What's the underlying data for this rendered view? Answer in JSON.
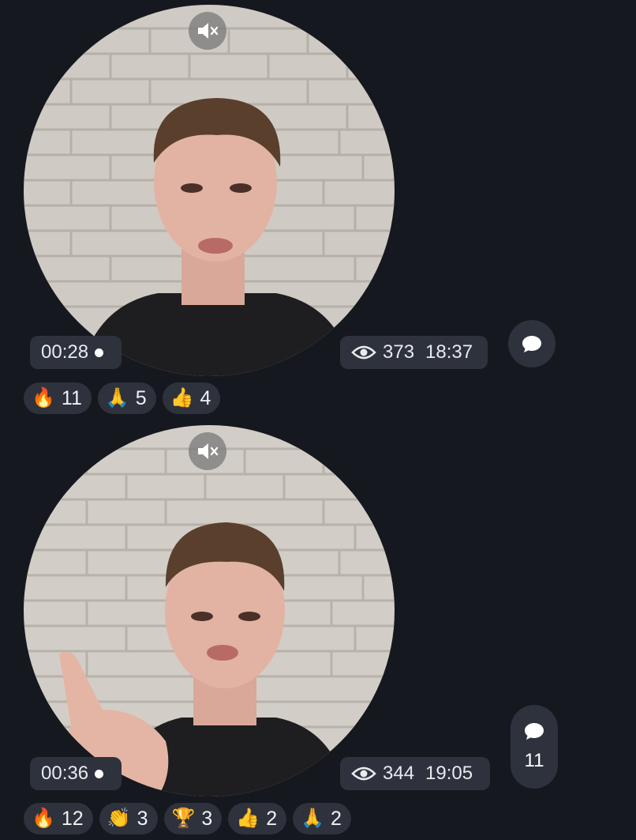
{
  "messages": [
    {
      "duration": "00:28",
      "views": "373",
      "time": "18:37",
      "comment_count": "",
      "reactions": [
        {
          "emoji": "🔥",
          "count": "11"
        },
        {
          "emoji": "🙏",
          "count": "5"
        },
        {
          "emoji": "👍",
          "count": "4"
        }
      ]
    },
    {
      "duration": "00:36",
      "views": "344",
      "time": "19:05",
      "comment_count": "11",
      "reactions": [
        {
          "emoji": "🔥",
          "count": "12"
        },
        {
          "emoji": "👏",
          "count": "3"
        },
        {
          "emoji": "🏆",
          "count": "3"
        },
        {
          "emoji": "👍",
          "count": "2"
        },
        {
          "emoji": "🙏",
          "count": "2"
        }
      ]
    }
  ],
  "icons": {
    "mute": "mute-icon",
    "views": "eye-icon",
    "comment": "comment-bubble-icon"
  },
  "colors": {
    "background": "#16181f",
    "pill": "#2e323c",
    "text": "#e8eaee"
  }
}
